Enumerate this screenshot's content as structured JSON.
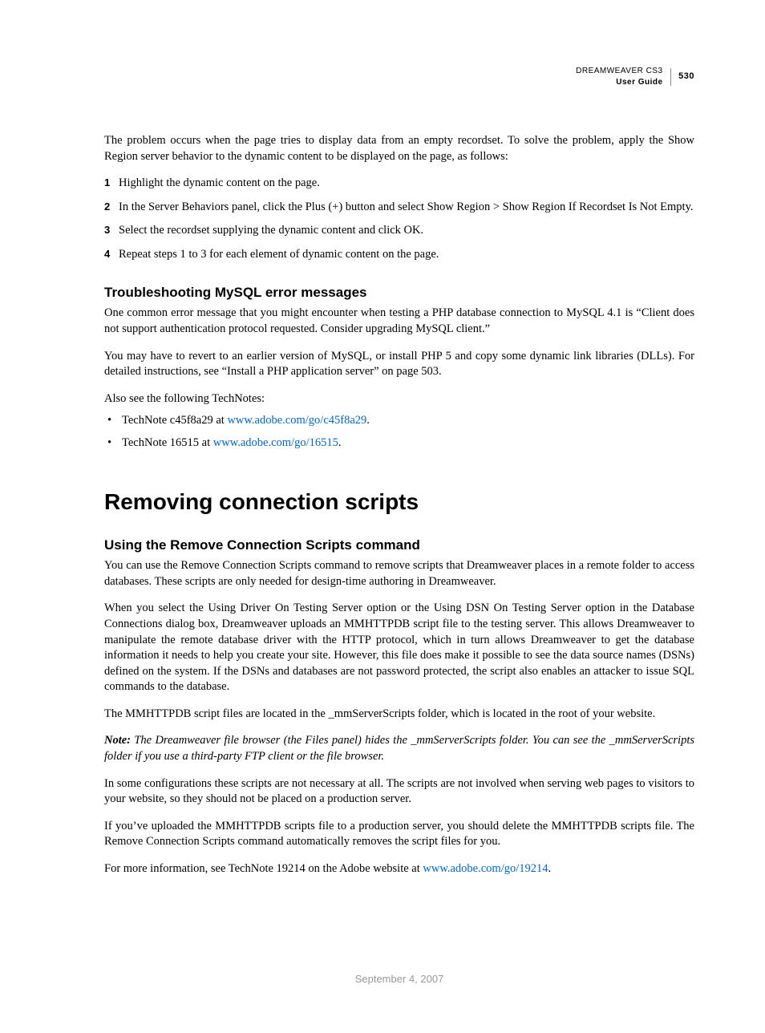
{
  "header": {
    "product": "DREAMWEAVER CS3",
    "guide": "User Guide",
    "page": "530"
  },
  "intro": "The problem occurs when the page tries to display data from an empty recordset. To solve the problem, apply the Show Region server behavior to the dynamic content to be displayed on the page, as follows:",
  "steps": {
    "s1n": "1",
    "s1": "Highlight the dynamic content on the page.",
    "s2n": "2",
    "s2": "In the Server Behaviors panel, click the Plus (+) button and select Show Region > Show Region If Recordset Is Not Empty.",
    "s3n": "3",
    "s3": "Select the recordset supplying the dynamic content and click OK.",
    "s4n": "4",
    "s4": "Repeat steps 1 to 3 for each element of dynamic content on the page."
  },
  "sub1": {
    "title": "Troubleshooting MySQL error messages",
    "p1": "One common error message that you might encounter when testing a PHP database connection to MySQL 4.1 is “Client does not support authentication protocol requested. Consider upgrading MySQL client.”",
    "p2": "You may have to revert to an earlier version of MySQL, or install PHP 5 and copy some dynamic link libraries (DLLs). For detailed instructions, see “Install a PHP application server” on page 503.",
    "p3": "Also see the following TechNotes:",
    "b1a": "TechNote c45f8a29 at ",
    "b1link": "www.adobe.com/go/c45f8a29",
    "b1b": ".",
    "b2a": "TechNote 16515 at ",
    "b2link": "www.adobe.com/go/16515",
    "b2b": "."
  },
  "chapter": "Removing connection scripts",
  "sub2": {
    "title": "Using the Remove Connection Scripts command",
    "p1": "You can use the Remove Connection Scripts command to remove scripts that Dreamweaver places in a remote folder to access databases. These scripts are only needed for design-time authoring in Dreamweaver.",
    "p2": "When you select the Using Driver On Testing Server option or the Using DSN On Testing Server option in the Database Connections dialog box, Dreamweaver uploads an MMHTTPDB script file to the testing server. This allows Dreamweaver to manipulate the remote database driver with the HTTP protocol, which in turn allows Dreamweaver to get the database information it needs to help you create your site. However, this file does make it possible to see the data source names (DSNs) defined on the system. If the DSNs and databases are not password protected, the script also enables an attacker to issue SQL commands to the database.",
    "p3": "The MMHTTPDB script files are located in the _mmServerScripts folder, which is located in the root of your website.",
    "noteLabel": "Note: ",
    "noteBody": "The Dreamweaver file browser (the Files panel) hides the _mmServerScripts folder. You can see the _mmServerScripts folder if you use a third-party FTP client or the file browser.",
    "p4": "In some configurations these scripts are not necessary at all. The scripts are not involved when serving web pages to visitors to your website, so they should not be placed on a production server.",
    "p5": "If you’ve uploaded the MMHTTPDB scripts file to a production server, you should delete the MMHTTPDB scripts file. The Remove Connection Scripts command automatically removes the script files for you.",
    "p6a": "For more information, see TechNote 19214 on the Adobe website at ",
    "p6link": "www.adobe.com/go/19214",
    "p6b": "."
  },
  "footer": {
    "date": "September 4, 2007"
  },
  "bullet": "•"
}
